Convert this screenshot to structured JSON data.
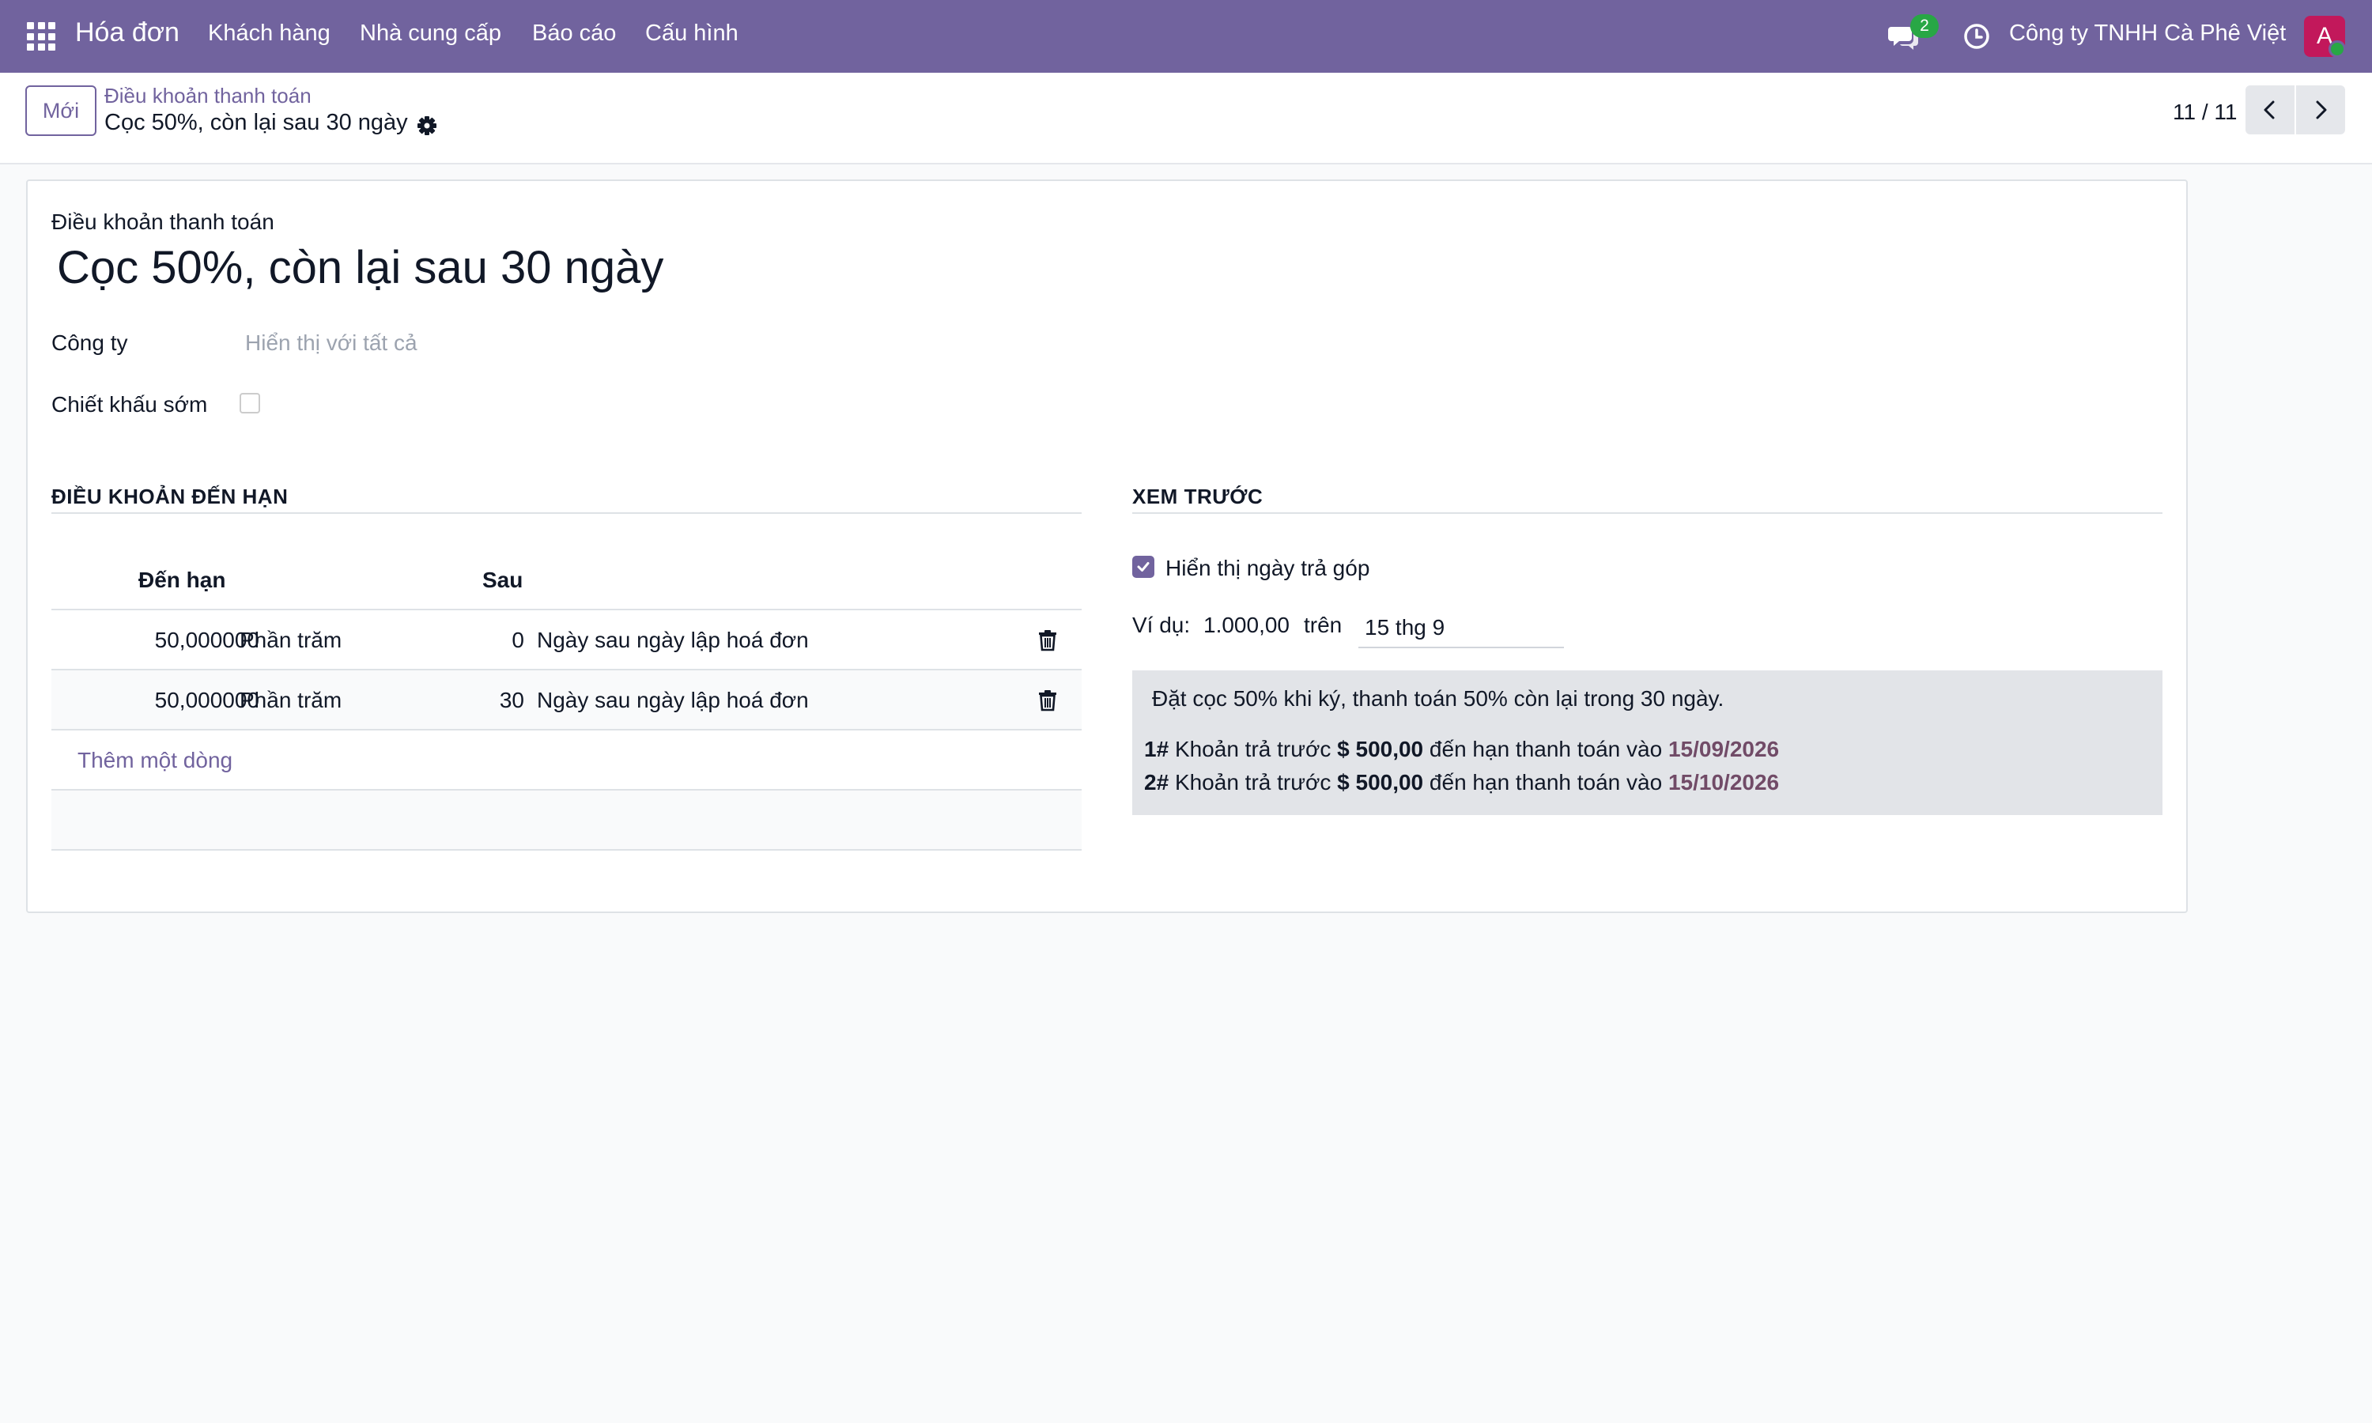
{
  "navbar": {
    "app_name": "Hóa đơn",
    "menu": [
      "Khách hàng",
      "Nhà cung cấp",
      "Báo cáo",
      "Cấu hình"
    ],
    "message_count": "2",
    "company": "Công ty TNHH Cà Phê Việt",
    "avatar_initial": "A"
  },
  "control": {
    "new_button": "Mới",
    "breadcrumb_parent": "Điều khoản thanh toán",
    "breadcrumb_current": "Cọc 50%, còn lại sau 30 ngày",
    "pager": "11 / 11"
  },
  "form": {
    "title_label": "Điều khoản thanh toán",
    "title": "Cọc 50%, còn lại sau 30 ngày",
    "company_label": "Công ty",
    "company_placeholder": "Hiển thị với tất cả",
    "early_discount_label": "Chiết khấu sớm",
    "early_discount_checked": false
  },
  "terms": {
    "section_title": "ĐIỀU KHOẢN ĐẾN HẠN",
    "headers": {
      "due": "Đến hạn",
      "after": "Sau"
    },
    "rows": [
      {
        "value": "50,000000",
        "value_type": "Phần trăm",
        "days": "0",
        "option": "Ngày sau ngày lập hoá đơn"
      },
      {
        "value": "50,000000",
        "value_type": "Phần trăm",
        "days": "30",
        "option": "Ngày sau ngày lập hoá đơn"
      }
    ],
    "add_line": "Thêm một dòng"
  },
  "preview": {
    "section_title": "XEM TRƯỚC",
    "show_installments_label": "Hiển thị ngày trả góp",
    "show_installments_checked": true,
    "example_label": "Ví dụ:",
    "example_amount": "1.000,00",
    "on_label": "trên",
    "example_date": "15 thg 9",
    "description": "Đặt cọc 50% khi ký, thanh toán 50% còn lại trong 30 ngày.",
    "installments": [
      {
        "index": "1#",
        "text": "Khoản trả trước",
        "amount": "$ 500,00",
        "due_text": "đến hạn thanh toán vào",
        "date": "15/09/2026"
      },
      {
        "index": "2#",
        "text": "Khoản trả trước",
        "amount": "$ 500,00",
        "due_text": "đến hạn thanh toán vào",
        "date": "15/10/2026"
      }
    ]
  },
  "colors": {
    "navbar": "#71639e",
    "accent": "#71639e",
    "date_highlight": "#714b67",
    "badge": "#28a745"
  }
}
